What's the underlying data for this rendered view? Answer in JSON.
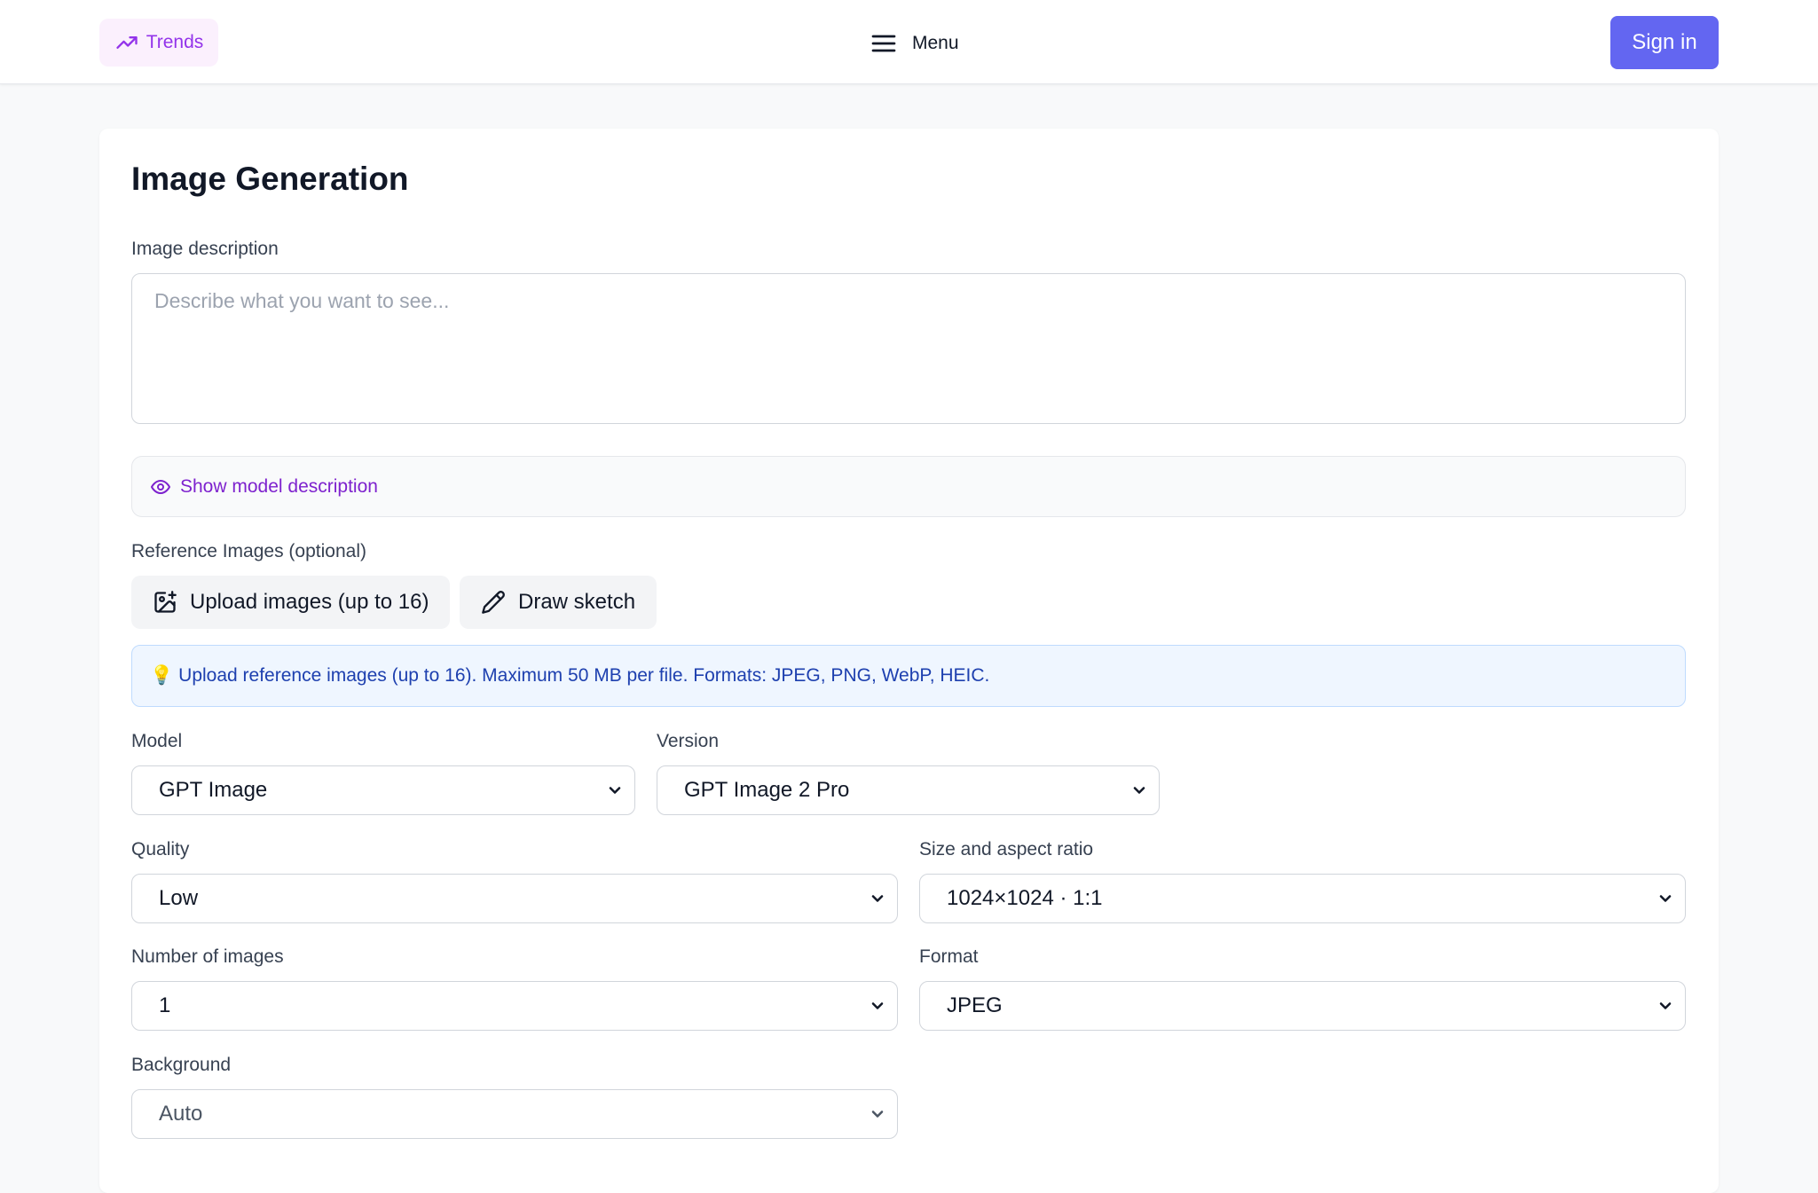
{
  "header": {
    "trends_label": "Trends",
    "menu_label": "Menu",
    "signin_label": "Sign in"
  },
  "page": {
    "title": "Image Generation",
    "description_label": "Image description",
    "description_placeholder": "Describe what you want to see...",
    "show_model_description": "Show model description",
    "reference_label": "Reference Images (optional)",
    "upload_button": "Upload images (up to 16)",
    "sketch_button": "Draw sketch",
    "info_emoji": "💡",
    "info_text": "Upload reference images (up to 16). Maximum 50 MB per file. Formats: JPEG, PNG, WebP, HEIC."
  },
  "fields": {
    "model": {
      "label": "Model",
      "value": "GPT Image"
    },
    "version": {
      "label": "Version",
      "value": "GPT Image 2 Pro"
    },
    "quality": {
      "label": "Quality",
      "value": "Low"
    },
    "size": {
      "label": "Size and aspect ratio",
      "value": "1024×1024 · 1:1"
    },
    "count": {
      "label": "Number of images",
      "value": "1"
    },
    "format": {
      "label": "Format",
      "value": "JPEG"
    },
    "background": {
      "label": "Background",
      "value": "Auto"
    }
  },
  "colors": {
    "accent": "#6366f1",
    "trends": "#9333ea",
    "info_bg": "#eff6ff",
    "info_text": "#1e40af"
  },
  "icons": [
    "trending-up-icon",
    "hamburger-menu-icon",
    "eye-icon",
    "image-plus-icon",
    "pencil-icon",
    "chevron-down-icon"
  ]
}
